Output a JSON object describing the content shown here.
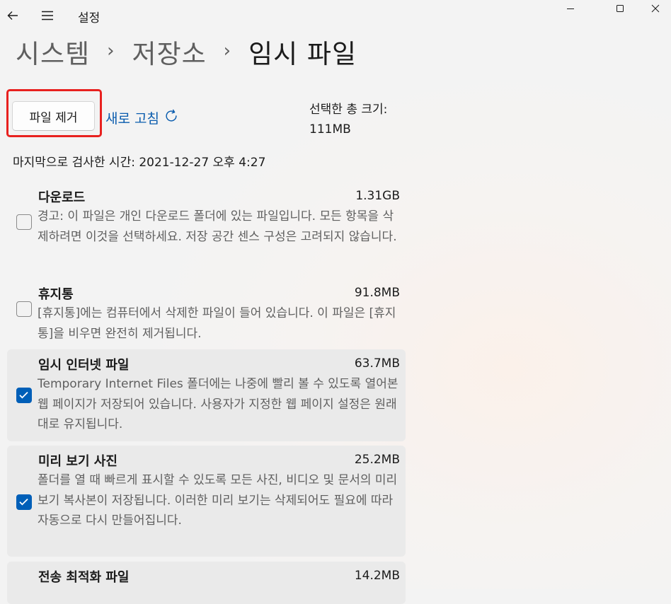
{
  "app": {
    "title": "설정"
  },
  "breadcrumb": {
    "level1": "시스템",
    "level2": "저장소",
    "current": "임시 파일",
    "separator": "›"
  },
  "actions": {
    "remove_files": "파일 제거",
    "refresh": "새로 고침"
  },
  "summary": {
    "total_label": "선택한 총 크기:",
    "total_value": "111MB"
  },
  "last_scan": "마지막으로 검사한 시간: 2021-12-27 오후 4:27",
  "items": [
    {
      "title": "다운로드",
      "size": "1.31GB",
      "checked": false,
      "desc": "경고: 이 파일은 개인 다운로드 폴더에 있는 파일입니다. 모든 항목을 삭제하려면 이것을 선택하세요. 저장 공간 센스 구성은 고려되지 않습니다."
    },
    {
      "title": "휴지통",
      "size": "91.8MB",
      "checked": false,
      "desc": "[휴지통]에는 컴퓨터에서 삭제한 파일이 들어 있습니다. 이 파일은 [휴지통]을 비우면 완전히 제거됩니다."
    },
    {
      "title": "임시 인터넷 파일",
      "size": "63.7MB",
      "checked": true,
      "desc": "Temporary Internet Files 폴더에는 나중에 빨리 볼 수 있도록 열어본 웹 페이지가 저장되어 있습니다. 사용자가 지정한 웹 페이지 설정은 원래대로 유지됩니다."
    },
    {
      "title": "미리 보기 사진",
      "size": "25.2MB",
      "checked": true,
      "desc": "폴더를 열 때 빠르게 표시할 수 있도록 모든 사진, 비디오 및 문서의 미리 보기 복사본이 저장됩니다. 이러한 미리 보기는 삭제되어도 필요에 따라 자동으로 다시 만들어집니다."
    },
    {
      "title": "전송 최적화 파일",
      "size": "14.2MB",
      "checked": true,
      "desc": ""
    }
  ],
  "colors": {
    "accent": "#005fb8",
    "link": "#0a5cae",
    "highlight": "#e8211f"
  }
}
